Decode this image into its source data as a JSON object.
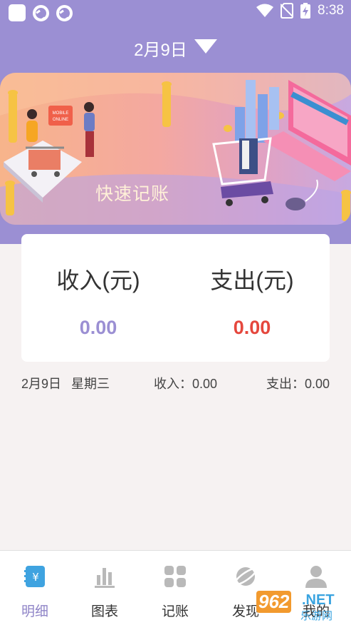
{
  "status_bar": {
    "time": "8:38"
  },
  "header": {
    "date": "2月9日"
  },
  "banner": {
    "caption": "快速记账",
    "sign_lines": [
      "MOBILE",
      "ONLINE"
    ]
  },
  "summary": {
    "income_label": "收入(元)",
    "income_value": "0.00",
    "expense_label": "支出(元)",
    "expense_value": "0.00",
    "income_color": "#9b8fd3",
    "expense_color": "#e5473d"
  },
  "day_row": {
    "date": "2月9日",
    "weekday": "星期三",
    "income": "收入：0.00",
    "expense": "支出：0.00"
  },
  "tabbar": {
    "items": [
      {
        "label": "明细",
        "icon": "notebook-yuan-icon",
        "active": true
      },
      {
        "label": "图表",
        "icon": "bar-chart-icon",
        "active": false
      },
      {
        "label": "记账",
        "icon": "grid-icon",
        "active": false
      },
      {
        "label": "发现",
        "icon": "planet-icon",
        "active": false
      },
      {
        "label": "我的",
        "icon": "person-icon",
        "active": false
      }
    ]
  },
  "watermark": {
    "brand": "962",
    "suffix": ".NET",
    "sub": "乐游网"
  }
}
